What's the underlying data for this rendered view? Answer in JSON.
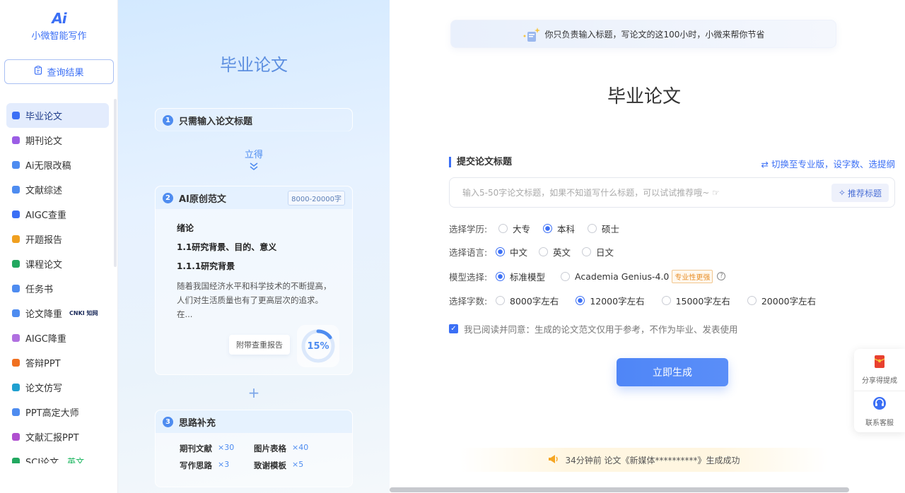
{
  "app": {
    "logo_mark": "Ai",
    "name": "小微智能写作"
  },
  "sidebar": {
    "query_button": "查询结果",
    "items": [
      {
        "label": "毕业论文",
        "active": true,
        "color": "#3b6ff5"
      },
      {
        "label": "期刊论文",
        "color": "#9b5de5"
      },
      {
        "label": "Ai无限改稿",
        "color": "#4e8cf0"
      },
      {
        "label": "文献综述",
        "color": "#4e8cf0"
      },
      {
        "label": "AIGC查重",
        "color": "#3b6ff5"
      },
      {
        "label": "开题报告",
        "color": "#f0a020"
      },
      {
        "label": "课程论文",
        "color": "#22a860"
      },
      {
        "label": "任务书",
        "color": "#4e8cf0"
      },
      {
        "label": "论文降重",
        "badge": "CNKI 知网",
        "color": "#4e8cf0"
      },
      {
        "label": "AIGC降重",
        "color": "#b070e0"
      },
      {
        "label": "答辩PPT",
        "color": "#f07020"
      },
      {
        "label": "论文仿写",
        "color": "#20a0d0"
      },
      {
        "label": "PPT高定大师",
        "color": "#4e8cf0"
      },
      {
        "label": "文献汇报PPT",
        "color": "#b050d0"
      },
      {
        "label": "SCI论文",
        "tag": "英文",
        "color": "#22a860"
      }
    ]
  },
  "hero": {
    "title": "毕业论文",
    "step1": {
      "num": "1",
      "label": "只需输入论文标题"
    },
    "arrow_label": "立得",
    "step2": {
      "num": "2",
      "label": "AI原创范文",
      "range": "8000-20000字"
    },
    "sample": {
      "h1": "绪论",
      "h2": "1.1研究背景、目的、意义",
      "h3": "1.1.1研究背景",
      "body": "随着我国经济水平和科学技术的不断提高，人们对生活质量也有了更高层次的追求。在..."
    },
    "report_chip": "附带查重报告",
    "ring_value": "15%",
    "ring_fraction": 0.15,
    "plus": "+",
    "step3": {
      "num": "3",
      "label": "思路补充"
    },
    "extras": [
      {
        "label": "期刊文献",
        "count": "×30"
      },
      {
        "label": "图片表格",
        "count": "×40"
      },
      {
        "label": "写作思路",
        "count": "×3"
      },
      {
        "label": "致谢模板",
        "count": "×5"
      }
    ]
  },
  "main": {
    "banner": "你只负责输入标题，写论文的这100小时，小微来帮你节省",
    "title": "毕业论文",
    "section_label": "提交论文标题",
    "switch_link": "切换至专业版，设字数、选提纲",
    "title_input_placeholder": "输入5-50字论文标题，如果不知道写什么标题，可以试试推荐哦~ ☞",
    "recommend_button": "推荐标题",
    "degree": {
      "label": "选择学历:",
      "options": [
        "大专",
        "本科",
        "硕士"
      ],
      "selected": "本科"
    },
    "language": {
      "label": "选择语言:",
      "options": [
        "中文",
        "英文",
        "日文"
      ],
      "selected": "中文"
    },
    "model": {
      "label": "模型选择:",
      "options": [
        "标准模型",
        "Academia Genius-4.0"
      ],
      "selected": "标准模型",
      "pro_tag": "专业性更强",
      "help": "?"
    },
    "wordcount": {
      "label": "选择字数:",
      "options": [
        "8000字左右",
        "12000字左右",
        "15000字左右",
        "20000字左右"
      ],
      "selected": "12000字左右"
    },
    "agree_text": "我已阅读并同意：生成的论文范文仅用于参考，不作为毕业、发表使用",
    "agree_checked": true,
    "generate_button": "立即生成",
    "ticker": "34分钟前 论文《新媒体**********》生成成功"
  },
  "float_panel": {
    "share": "分享得提成",
    "support": "联系客服"
  }
}
